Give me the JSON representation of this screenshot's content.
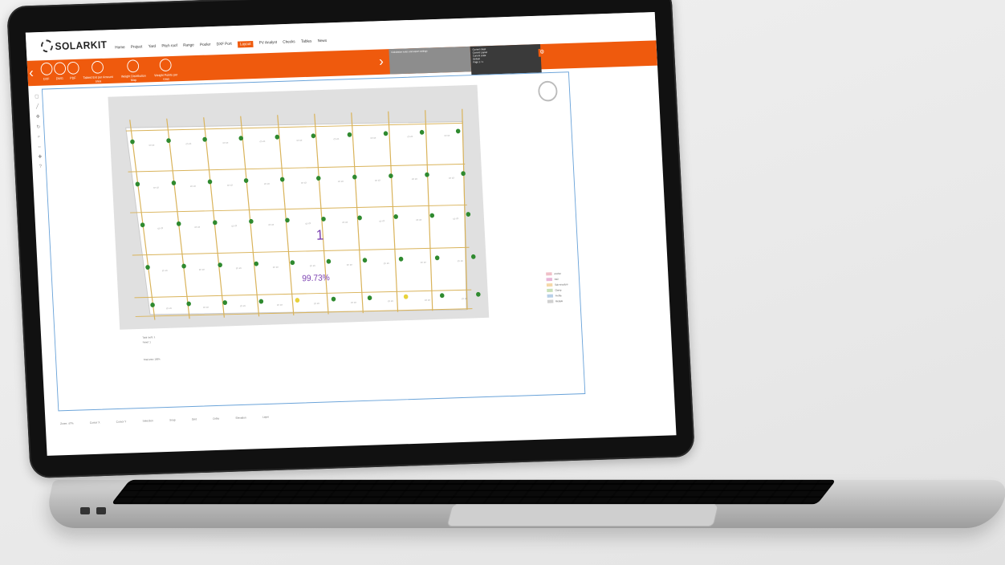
{
  "app": {
    "brand": "SOLARKIT"
  },
  "nav": [
    "Home",
    "Project",
    "Yard",
    "Pitch roof",
    "Range",
    "Pooler",
    "DXF Port",
    "Layout",
    "PV Analyst",
    "Checks",
    "Tables",
    "News"
  ],
  "nav_active_index": 7,
  "ribbon": {
    "buttons": [
      "DXF",
      "DWG",
      "PDF",
      "Tabled Ent per Amount area",
      "Weight Distribution Map",
      "Weight Points per rows"
    ],
    "gray_panel_text": "Calculation notes and export settings",
    "dark_panel": [
      "Current sheet",
      "Current Layout",
      "Current scale",
      "Default",
      "Page 1 / 1"
    ]
  },
  "workspace": {
    "roof_number": "1",
    "roof_percent": "99.73%",
    "notes": [
      "Total roofs: 1",
      "Panel: 1"
    ],
    "bottom_note": "Total area: 100%"
  },
  "legend": [
    "Anchor",
    "Rail",
    "Sub-structure",
    "Clamp",
    "Profile",
    "Module"
  ],
  "status_bar": [
    "Zoom: 47%",
    "Cursor X",
    "Cursor Y",
    "Selection",
    "Snap",
    "Grid",
    "Ortho",
    "Elevation",
    "Layer"
  ],
  "colors": {
    "accent": "#ef5a0d",
    "frame": "#6aa3d9",
    "anchor": "#2f8a2f",
    "anchor_alt": "#e8d23a",
    "rail": "#d9b35a",
    "label": "#7a3fb0"
  }
}
